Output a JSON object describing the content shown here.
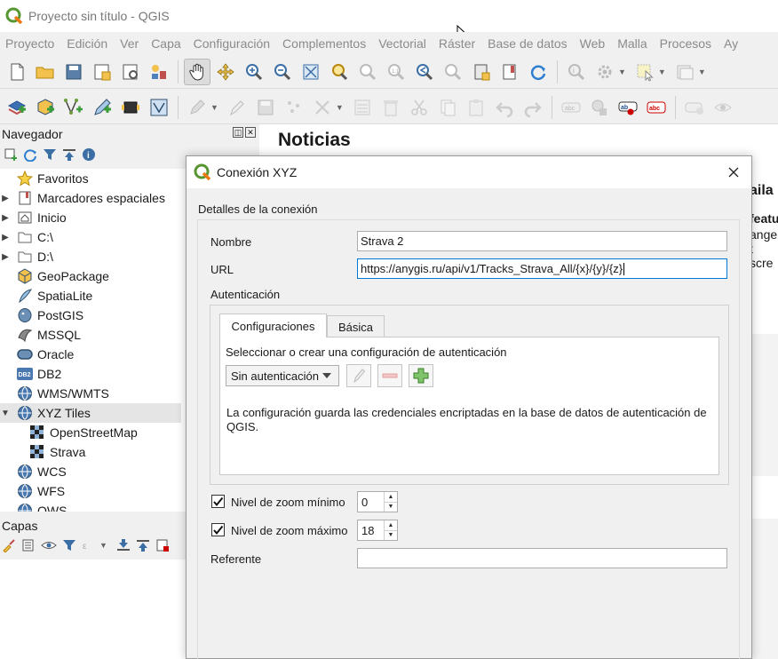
{
  "window": {
    "title": "Proyecto sin título - QGIS"
  },
  "menu": [
    "Proyecto",
    "Edición",
    "Ver",
    "Capa",
    "Configuración",
    "Complementos",
    "Vectorial",
    "Ráster",
    "Base de datos",
    "Web",
    "Malla",
    "Procesos",
    "Ay"
  ],
  "navigator": {
    "title": "Navegador",
    "items": [
      {
        "label": "Favoritos",
        "icon": "star-icon",
        "expandable": false
      },
      {
        "label": "Marcadores espaciales",
        "icon": "bookmark-icon",
        "expandable": true
      },
      {
        "label": "Inicio",
        "icon": "home-folder-icon",
        "expandable": true
      },
      {
        "label": "C:\\",
        "icon": "drive-icon",
        "expandable": true
      },
      {
        "label": "D:\\",
        "icon": "drive-icon",
        "expandable": true
      },
      {
        "label": "GeoPackage",
        "icon": "geopackage-icon",
        "expandable": false
      },
      {
        "label": "SpatiaLite",
        "icon": "spatialite-icon",
        "expandable": false
      },
      {
        "label": "PostGIS",
        "icon": "postgis-icon",
        "expandable": false
      },
      {
        "label": "MSSQL",
        "icon": "mssql-icon",
        "expandable": false
      },
      {
        "label": "Oracle",
        "icon": "oracle-icon",
        "expandable": false
      },
      {
        "label": "DB2",
        "icon": "db2-icon",
        "expandable": false
      },
      {
        "label": "WMS/WMTS",
        "icon": "globe-icon",
        "expandable": false
      },
      {
        "label": "XYZ Tiles",
        "icon": "globe-icon",
        "expandable": true,
        "expanded": true
      },
      {
        "label": "OpenStreetMap",
        "icon": "xyz-tile-icon",
        "child": true
      },
      {
        "label": "Strava",
        "icon": "xyz-tile-icon",
        "child": true
      },
      {
        "label": "WCS",
        "icon": "globe-icon",
        "expandable": false
      },
      {
        "label": "WFS",
        "icon": "globe-icon",
        "expandable": false
      },
      {
        "label": "OWS",
        "icon": "globe-icon",
        "expandable": false
      }
    ]
  },
  "layers": {
    "title": "Capas"
  },
  "news": {
    "title": "Noticias",
    "fragments": [
      "aila",
      "featu",
      "angel",
      "t scre"
    ]
  },
  "dialog": {
    "title": "Conexión XYZ",
    "group_title": "Detalles de la conexión",
    "name_label": "Nombre",
    "name_value": "Strava 2",
    "url_label": "URL",
    "url_value": "https://anygis.ru/api/v1/Tracks_Strava_All/{x}/{y}/{z}",
    "auth_label": "Autenticación",
    "tabs": [
      "Configuraciones",
      "Básica"
    ],
    "auth_prompt": "Seleccionar o crear una configuración de autenticación",
    "auth_combo": "Sin autenticación",
    "auth_note": "La configuración guarda las credenciales encriptadas en la base de datos de autenticación de QGIS.",
    "zoom_min_label": "Nivel de zoom mínimo",
    "zoom_min_value": "0",
    "zoom_min_checked": true,
    "zoom_max_label": "Nivel de zoom máximo",
    "zoom_max_value": "18",
    "zoom_max_checked": true,
    "referer_label": "Referente",
    "referer_value": ""
  }
}
